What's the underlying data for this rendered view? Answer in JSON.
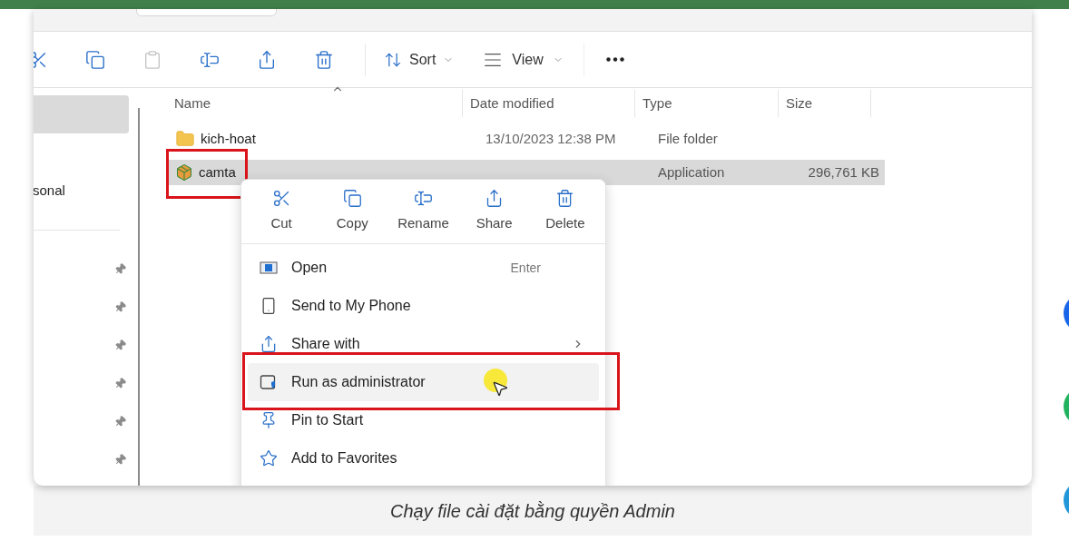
{
  "toolbar": {
    "buttons": [
      {
        "kind": "cut",
        "disabled": false
      },
      {
        "kind": "copy",
        "disabled": false
      },
      {
        "kind": "paste",
        "disabled": true
      },
      {
        "kind": "rename",
        "disabled": false
      },
      {
        "kind": "share",
        "disabled": false
      },
      {
        "kind": "delete",
        "disabled": false
      }
    ],
    "sort": {
      "label": "Sort"
    },
    "view": {
      "label": "View"
    }
  },
  "nav": {
    "items": [
      {
        "kind": "blank",
        "selected": true
      },
      {
        "kind": "text",
        "label": "sonal",
        "selected": false
      },
      {
        "kind": "divider"
      },
      {
        "kind": "pinned"
      },
      {
        "kind": "pinned"
      },
      {
        "kind": "pinned"
      },
      {
        "kind": "pinned"
      },
      {
        "kind": "pinned"
      },
      {
        "kind": "pinned"
      }
    ]
  },
  "table": {
    "columns": [
      {
        "label": "Name",
        "sorted": true
      },
      {
        "label": "Date modified",
        "sorted": false
      },
      {
        "label": "Type",
        "sorted": false
      },
      {
        "label": "Size",
        "sorted": false
      }
    ],
    "rows": [
      {
        "kind": "folder",
        "name": "kich-hoat",
        "date": "13/10/2023 12:38 PM",
        "type": "File folder",
        "selected": false,
        "highlighted": false
      },
      {
        "kind": "app",
        "name": "camta",
        "type": "Application",
        "size": "296,761 KB",
        "selected": true,
        "highlighted": true
      }
    ]
  },
  "context_menu": {
    "quick_actions": [
      {
        "kind": "cut",
        "label": "Cut"
      },
      {
        "kind": "copy",
        "label": "Copy"
      },
      {
        "kind": "rename",
        "label": "Rename"
      },
      {
        "kind": "share",
        "label": "Share"
      },
      {
        "kind": "delete",
        "label": "Delete"
      }
    ],
    "items": [
      {
        "kind": "open",
        "label": "Open",
        "shortcut": "Enter",
        "hovered": false,
        "highlighted": false
      },
      {
        "kind": "phone",
        "label": "Send to My Phone",
        "hovered": false,
        "highlighted": false
      },
      {
        "kind": "share",
        "label": "Share with",
        "submenu": true,
        "hovered": false,
        "highlighted": false
      },
      {
        "kind": "admin",
        "label": "Run as administrator",
        "hovered": true,
        "highlighted": true
      },
      {
        "kind": "pin",
        "label": "Pin to Start",
        "hovered": false,
        "highlighted": false
      },
      {
        "kind": "star",
        "label": "Add to Favorites",
        "hovered": false,
        "highlighted": false
      }
    ]
  },
  "caption": "Chạy file cài đặt bằng quyền Admin",
  "floating_buttons": [
    {
      "color": "#1a66e8"
    },
    {
      "color": "#22b35e"
    },
    {
      "color": "#2196d8"
    }
  ]
}
